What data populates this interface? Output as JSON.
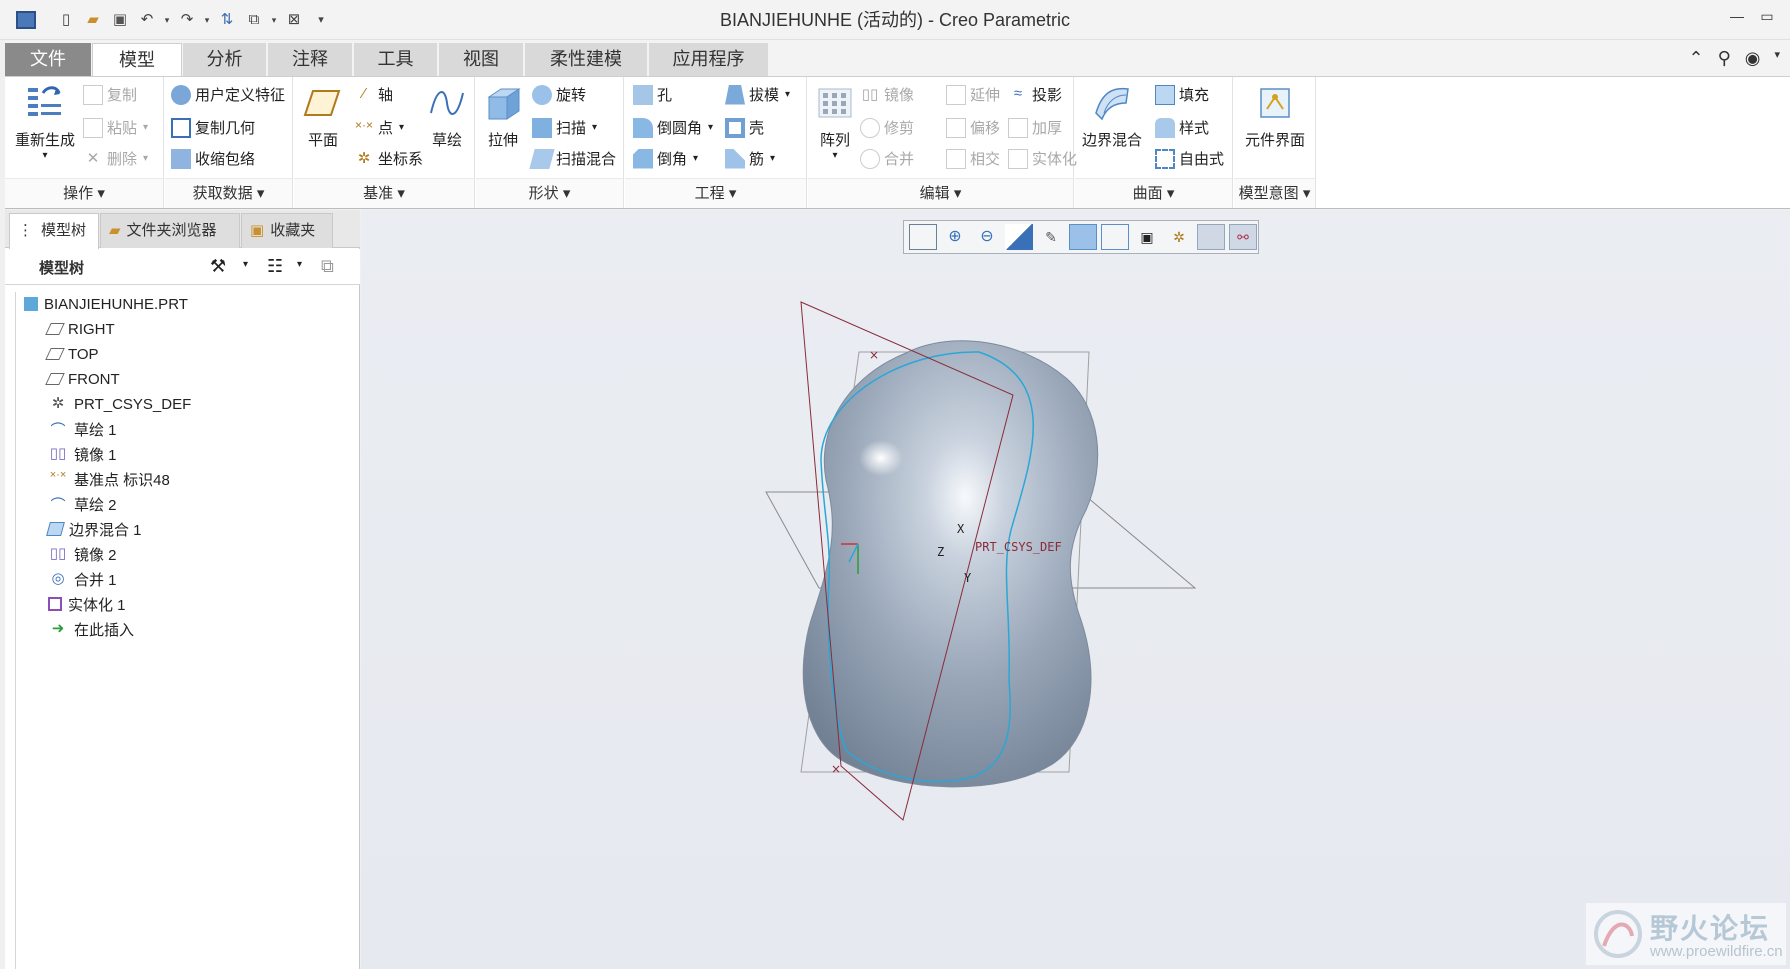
{
  "window": {
    "title": "BIANJIEHUNHE (活动的) - Creo Parametric",
    "controls": [
      "—",
      "▭"
    ]
  },
  "menu": {
    "tabs": [
      "文件",
      "模型",
      "分析",
      "注释",
      "工具",
      "视图",
      "柔性建模",
      "应用程序"
    ],
    "active": "模型"
  },
  "ribbon": {
    "operations": {
      "regenerate": "重新生成",
      "copy": "复制",
      "paste": "粘贴",
      "delete": "删除",
      "label": "操作"
    },
    "get_data": {
      "udf": "用户定义特征",
      "copy_geom": "复制几何",
      "shrinkwrap": "收缩包络",
      "label": "获取数据"
    },
    "datum": {
      "plane": "平面",
      "axis": "轴",
      "point": "点",
      "csys": "坐标系",
      "sketch": "草绘",
      "label": "基准"
    },
    "shapes": {
      "extrude": "拉伸",
      "revolve": "旋转",
      "sweep": "扫描",
      "swept_blend": "扫描混合",
      "label": "形状"
    },
    "engineering": {
      "hole": "孔",
      "draft": "拔模",
      "round": "倒圆角",
      "shell": "壳",
      "chamfer": "倒角",
      "rib": "筋",
      "label": "工程"
    },
    "editing": {
      "pattern": "阵列",
      "mirror": "镜像",
      "extend": "延伸",
      "project": "投影",
      "trim": "修剪",
      "offset": "偏移",
      "thicken": "加厚",
      "merge": "合并",
      "intersect": "相交",
      "solidify": "实体化",
      "label": "编辑"
    },
    "surfaces": {
      "boundary_blend": "边界混合",
      "fill": "填充",
      "style": "样式",
      "freestyle": "自由式",
      "label": "曲面"
    },
    "model_intent": {
      "component_interface": "元件界面",
      "label": "模型意图"
    }
  },
  "left_panel": {
    "tabs": [
      "模型树",
      "文件夹浏览器",
      "收藏夹"
    ],
    "header": "模型树",
    "tree": [
      {
        "label": "BIANJIEHUNHE.PRT",
        "icon": "part-icon"
      },
      {
        "label": "RIGHT",
        "icon": "datum-plane-icon"
      },
      {
        "label": "TOP",
        "icon": "datum-plane-icon"
      },
      {
        "label": "FRONT",
        "icon": "datum-plane-icon"
      },
      {
        "label": "PRT_CSYS_DEF",
        "icon": "csys-icon"
      },
      {
        "label": "草绘 1",
        "icon": "sketch-icon"
      },
      {
        "label": "镜像 1",
        "icon": "mirror-icon"
      },
      {
        "label": "基准点 标识48",
        "icon": "datum-point-icon"
      },
      {
        "label": "草绘 2",
        "icon": "sketch-icon"
      },
      {
        "label": "边界混合 1",
        "icon": "boundary-blend-icon"
      },
      {
        "label": "镜像 2",
        "icon": "mirror-icon"
      },
      {
        "label": "合并 1",
        "icon": "merge-icon"
      },
      {
        "label": "实体化 1",
        "icon": "solidify-icon"
      },
      {
        "label": "在此插入",
        "icon": "insert-here-arrow-icon"
      }
    ]
  },
  "graphics": {
    "csys_label": "PRT_CSYS_DEF",
    "axis_x": "X",
    "axis_y": "Y",
    "axis_z": "Z"
  },
  "watermark": {
    "title": "野火论坛",
    "url": "www.proewildfire.cn"
  }
}
